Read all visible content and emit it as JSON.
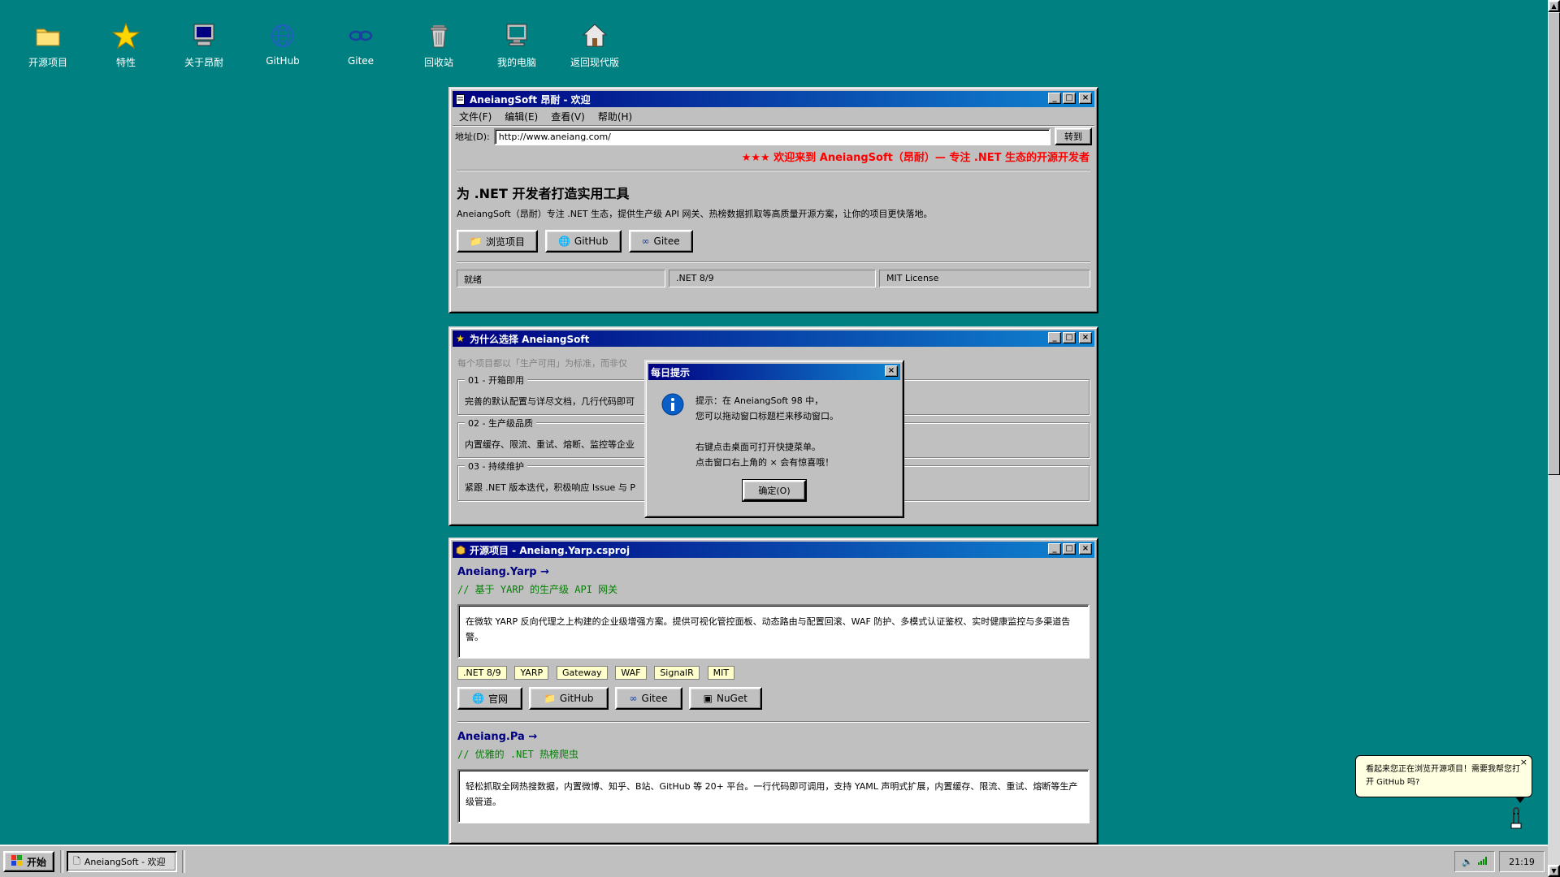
{
  "desktop": {
    "icons": [
      {
        "label": "开源项目",
        "icon": "folder-icon"
      },
      {
        "label": "特性",
        "icon": "star-icon"
      },
      {
        "label": "关于昂耐",
        "icon": "computer-icon"
      },
      {
        "label": "GitHub",
        "icon": "globe-icon"
      },
      {
        "label": "Gitee",
        "icon": "link-icon"
      },
      {
        "label": "回收站",
        "icon": "recycle-bin-icon"
      },
      {
        "label": "我的电脑",
        "icon": "my-computer-icon"
      },
      {
        "label": "返回现代版",
        "icon": "home-icon"
      }
    ]
  },
  "welcome_window": {
    "title": "AneiangSoft 昂耐 - 欢迎",
    "menu": [
      "文件(F)",
      "编辑(E)",
      "查看(V)",
      "帮助(H)"
    ],
    "address_label": "地址(D):",
    "address_value": "http://www.aneiang.com/",
    "go_button": "转到",
    "marquee": "★★★ 欢迎来到 AneiangSoft（昂耐）— 专注 .NET 生态的开源开发者",
    "headline": "为 .NET 开发者打造实用工具",
    "description": "AneiangSoft（昂耐）专注 .NET 生态，提供生产级 API 网关、热榜数据抓取等高质量开源方案，让你的项目更快落地。",
    "buttons": [
      "浏览项目",
      "GitHub",
      "Gitee"
    ],
    "status": [
      "就绪",
      ".NET 8/9",
      "MIT License"
    ]
  },
  "features_window": {
    "title": "为什么选择 AneiangSoft",
    "intro": "每个项目都以「生产可用」为标准，而非仅",
    "groups": [
      {
        "legend": "01 - 开箱即用",
        "text": "完善的默认配置与详尽文档，几行代码即可"
      },
      {
        "legend": "02 - 生产级品质",
        "text": "内置缓存、限流、重试、熔断、监控等企业"
      },
      {
        "legend": "03 - 持续维护",
        "text": "紧跟 .NET 版本迭代，积极响应 Issue 与 P"
      }
    ]
  },
  "projects_window": {
    "title": "开源项目 - Aneiang.Yarp.csproj",
    "projects": [
      {
        "name": "Aneiang.Yarp →",
        "comment": "// 基于 YARP 的生产级 API 网关",
        "description": "在微软 YARP 反向代理之上构建的企业级增强方案。提供可视化管控面板、动态路由与配置回滚、WAF 防护、多模式认证鉴权、实时健康监控与多渠道告警。",
        "tags": [
          ".NET 8/9",
          "YARP",
          "Gateway",
          "WAF",
          "SignalR",
          "MIT"
        ],
        "buttons": [
          "官网",
          "GitHub",
          "Gitee",
          "NuGet"
        ]
      },
      {
        "name": "Aneiang.Pa →",
        "comment": "// 优雅的 .NET 热榜爬虫",
        "description": "轻松抓取全网热搜数据，内置微博、知乎、B站、GitHub 等 20+ 平台。一行代码即可调用，支持 YAML 声明式扩展，内置缓存、限流、重试、熔断等生产级管道。"
      }
    ]
  },
  "dialog": {
    "title": "每日提示",
    "lines": [
      "提示：在 AneiangSoft 98 中，",
      "您可以拖动窗口标题栏来移动窗口。",
      "右键点击桌面可打开快捷菜单。",
      "点击窗口右上角的 × 会有惊喜哦！"
    ],
    "ok_button": "确定(O)"
  },
  "assistant_bubble": {
    "text": "看起来您正在浏览开源项目！需要我帮您打开 GitHub 吗?",
    "close": "×"
  },
  "taskbar": {
    "start_label": "开始",
    "tasks": [
      "AneiangSoft - 欢迎"
    ],
    "clock": "21:19"
  },
  "colors": {
    "desktop": "#008080",
    "title_active": "#000080",
    "marquee_red": "#ff0000",
    "link_blue": "#000080",
    "comment_green": "#008000"
  }
}
